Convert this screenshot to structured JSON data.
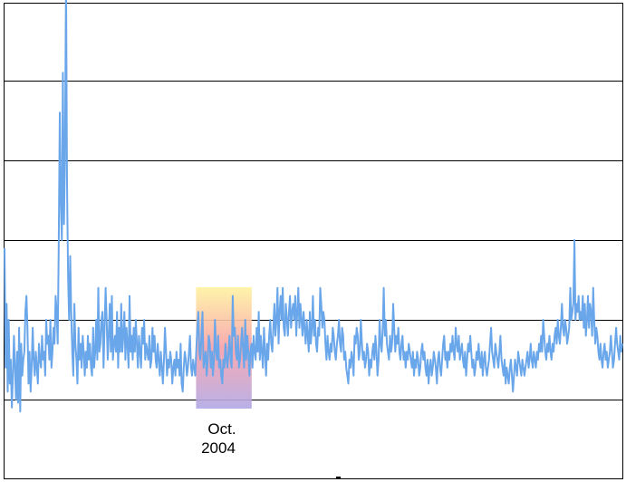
{
  "chart_data": {
    "type": "line",
    "title": "",
    "xlabel": "",
    "ylabel": "",
    "ylim": [
      0,
      6
    ],
    "grid": true,
    "colors": {
      "series": "#6aa6ea",
      "highlight_top": "#fff3a0",
      "highlight_mid": "#f8a0a8",
      "highlight_bottom": "#b0a8e6",
      "gridline": "#000000"
    },
    "gridlines_y": [
      1,
      2,
      3,
      4,
      5
    ],
    "annotation": {
      "line1": "Oct.",
      "line2": "2004",
      "x_start": 0.31,
      "x_end": 0.4
    },
    "series": [
      {
        "values": [
          2.9,
          1.4,
          2.2,
          1.1,
          2.0,
          1.2,
          1.5,
          0.9,
          1.3,
          1.8,
          1.4,
          1.0,
          1.6,
          0.96,
          1.9,
          0.85,
          1.7,
          1.3,
          1.5,
          1.6,
          2.1,
          2.3,
          1.9,
          1.2,
          1.6,
          1.1,
          1.4,
          1.9,
          1.5,
          1.3,
          1.6,
          1.4,
          1.2,
          1.7,
          1.5,
          1.4,
          1.8,
          1.5,
          1.6,
          1.3,
          2.0,
          1.7,
          1.8,
          1.5,
          2.0,
          1.4,
          1.6,
          1.9,
          1.7,
          2.3,
          2.1,
          1.7,
          2.9,
          4.6,
          3.5,
          3.0,
          5.1,
          3.2,
          4.0,
          6.3,
          3.7,
          2.5,
          2.0,
          2.8,
          2.1,
          1.6,
          1.3,
          2.2,
          1.7,
          1.5,
          1.2,
          1.9,
          1.5,
          1.7,
          1.4,
          1.8,
          1.6,
          1.3,
          1.6,
          1.4,
          1.8,
          1.5,
          1.7,
          1.4,
          1.3,
          1.9,
          1.4,
          1.6,
          2.0,
          1.5,
          2.4,
          1.6,
          1.7,
          2.0,
          2.1,
          1.4,
          1.9,
          2.4,
          2.0,
          1.5,
          1.8,
          2.2,
          1.6,
          2.3,
          1.5,
          1.7,
          1.8,
          1.6,
          2.1,
          1.4,
          1.9,
          1.6,
          2.2,
          1.6,
          1.8,
          2.1,
          1.5,
          1.9,
          1.7,
          1.4,
          2.3,
          1.6,
          1.8,
          1.5,
          1.9,
          1.6,
          2.0,
          1.7,
          1.4,
          1.8,
          1.6,
          1.4,
          1.9,
          1.7,
          2.0,
          1.5,
          1.7,
          1.6,
          1.5,
          1.8,
          1.4,
          1.5,
          1.9,
          1.6,
          1.8,
          1.5,
          1.4,
          1.7,
          1.5,
          1.3,
          1.6,
          1.4,
          1.2,
          1.5,
          1.9,
          1.6,
          1.3,
          1.5,
          1.4,
          1.6,
          1.5,
          1.2,
          1.4,
          1.5,
          1.3,
          1.6,
          1.4,
          1.5,
          1.3,
          1.7,
          1.2,
          1.1,
          1.4,
          1.6,
          1.5,
          1.3,
          1.4,
          1.6,
          1.8,
          1.4,
          1.3,
          1.5,
          1.4,
          1.3,
          1.6,
          1.9,
          2.1,
          1.6,
          1.5,
          1.8,
          2.1,
          1.4,
          1.5,
          1.6,
          1.3,
          1.5,
          1.8,
          1.7,
          1.4,
          1.6,
          1.3,
          1.5,
          2.0,
          1.6,
          1.5,
          1.8,
          1.4,
          1.5,
          1.3,
          1.2,
          1.5,
          1.4,
          1.7,
          1.5,
          1.4,
          1.6,
          1.8,
          1.5,
          1.4,
          2.3,
          1.8,
          1.9,
          1.6,
          1.5,
          1.8,
          1.4,
          1.5,
          1.7,
          1.9,
          1.6,
          1.4,
          2.0,
          1.5,
          1.8,
          1.6,
          1.3,
          1.6,
          1.7,
          1.4,
          1.8,
          1.6,
          1.5,
          1.9,
          1.6,
          2.1,
          1.5,
          1.8,
          1.6,
          1.4,
          1.9,
          1.6,
          1.3,
          1.7,
          1.5,
          1.8,
          2.0,
          1.7,
          1.6,
          1.9,
          2.2,
          1.8,
          2.0,
          2.4,
          1.7,
          2.1,
          2.3,
          2.0,
          2.4,
          1.9,
          1.8,
          2.2,
          2.0,
          1.8,
          2.1,
          2.3,
          1.9,
          2.1,
          2.2,
          2.0,
          2.3,
          1.8,
          2.1,
          2.4,
          1.9,
          2.2,
          2.0,
          1.8,
          2.1,
          1.9,
          1.7,
          2.0,
          1.8,
          1.6,
          2.1,
          1.7,
          1.9,
          2.3,
          1.8,
          2.0,
          1.7,
          1.6,
          1.9,
          1.8,
          2.4,
          2.2,
          1.9,
          2.1,
          2.0,
          1.7,
          1.5,
          1.8,
          1.6,
          1.5,
          1.7,
          1.6,
          1.9,
          1.8,
          1.6,
          1.5,
          1.7,
          1.8,
          2.0,
          1.7,
          1.6,
          1.9,
          1.8,
          1.5,
          1.6,
          1.4,
          1.3,
          1.2,
          1.5,
          1.4,
          1.6,
          1.5,
          1.3,
          1.8,
          1.7,
          1.9,
          1.8,
          1.5,
          1.6,
          2.0,
          1.7,
          1.5,
          1.6,
          1.4,
          1.5,
          1.7,
          1.6,
          1.3,
          1.5,
          1.4,
          1.6,
          1.7,
          1.5,
          1.8,
          1.6,
          1.3,
          1.5,
          2.0,
          1.7,
          1.6,
          1.9,
          2.4,
          1.8,
          2.0,
          1.7,
          1.6,
          1.5,
          1.8,
          1.6,
          1.7,
          2.2,
          1.9,
          1.6,
          1.8,
          1.7,
          1.9,
          1.6,
          1.5,
          1.7,
          1.8,
          1.5,
          1.6,
          1.4,
          1.6,
          1.5,
          1.7,
          1.6,
          1.5,
          1.4,
          1.6,
          1.3,
          1.5,
          1.4,
          1.6,
          1.5,
          1.3,
          1.4,
          1.6,
          1.7,
          1.5,
          1.6,
          1.4,
          1.3,
          1.5,
          1.2,
          1.4,
          1.5,
          1.3,
          1.4,
          1.6,
          1.5,
          1.4,
          1.2,
          1.5,
          1.6,
          1.4,
          1.3,
          1.5,
          1.7,
          1.8,
          1.5,
          1.6,
          1.4,
          1.6,
          1.5,
          1.7,
          1.6,
          1.8,
          1.6,
          1.5,
          1.9,
          1.7,
          1.6,
          1.8,
          1.5,
          1.6,
          1.7,
          1.5,
          1.4,
          1.6,
          1.3,
          1.5,
          1.7,
          1.6,
          1.8,
          1.6,
          1.4,
          1.5,
          1.3,
          1.4,
          1.6,
          1.5,
          1.7,
          1.5,
          1.4,
          1.6,
          1.3,
          1.5,
          1.6,
          1.4,
          1.3,
          1.4,
          1.5,
          1.7,
          1.9,
          1.6,
          1.5,
          1.4,
          1.7,
          1.6,
          1.5,
          1.4,
          1.6,
          1.8,
          1.5,
          1.4,
          1.3,
          1.5,
          1.2,
          1.4,
          1.3,
          1.2,
          1.4,
          1.5,
          1.3,
          1.1,
          1.3,
          1.5,
          1.4,
          1.3,
          1.6,
          1.5,
          1.4,
          1.3,
          1.5,
          1.4,
          1.3,
          1.4,
          1.5,
          1.6,
          1.4,
          1.5,
          1.7,
          1.5,
          1.4,
          1.6,
          1.5,
          1.4,
          1.6,
          1.5,
          1.7,
          1.6,
          1.8,
          1.6,
          2.0,
          1.8,
          1.6,
          1.5,
          1.7,
          1.6,
          1.8,
          1.6,
          1.5,
          1.7,
          1.6,
          1.8,
          1.9,
          1.7,
          2.0,
          1.8,
          1.7,
          1.9,
          2.2,
          1.9,
          1.8,
          2.0,
          1.9,
          1.7,
          1.8,
          1.9,
          2.4,
          2.0,
          2.1,
          2.2,
          3.0,
          2.0,
          2.2,
          2.1,
          2.3,
          2.0,
          2.1,
          2.0,
          2.3,
          1.9,
          2.2,
          1.8,
          2.0,
          2.3,
          1.9,
          2.2,
          2.1,
          1.8,
          2.4,
          2.0,
          1.7,
          1.9,
          1.8,
          1.6,
          1.5,
          1.7,
          1.5,
          1.4,
          1.6,
          1.7,
          1.5,
          1.6,
          1.4,
          1.5,
          1.6,
          1.8,
          1.6,
          1.4,
          1.5,
          1.7,
          1.9,
          1.7,
          1.6,
          1.5,
          1.8,
          1.6,
          1.7
        ]
      }
    ]
  }
}
